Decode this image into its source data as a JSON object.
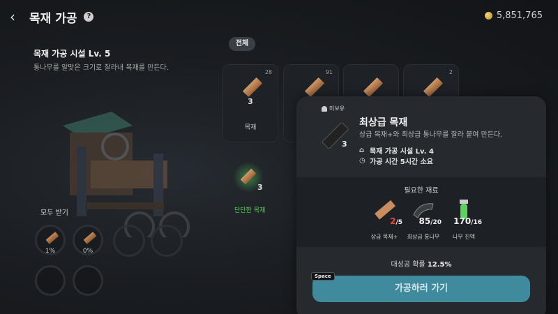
{
  "header": {
    "back_icon": "chevron-left-icon",
    "title": "목재 가공",
    "help_icon": "?",
    "coins": "5,851,765"
  },
  "facility": {
    "name": "목재 가공 시설 Lv. 5",
    "description": "통나무를 알맞은 크기로 잘라내 목재를 만든다."
  },
  "collect": {
    "label": "모두 받기",
    "slots": [
      {
        "percent": "1%"
      },
      {
        "percent": "0%"
      }
    ]
  },
  "filter": {
    "all_label": "전체"
  },
  "recipes": [
    {
      "owned": "28",
      "qty": "3",
      "name": "목재"
    },
    {
      "owned": "91",
      "qty": "",
      "name": ""
    },
    {
      "owned": "",
      "qty": "",
      "name": ""
    },
    {
      "owned": "2",
      "qty": "",
      "name": ""
    }
  ],
  "recipe_glow": {
    "qty": "3",
    "name": "단단한 목재"
  },
  "detail": {
    "unowned_label": "미보유",
    "item_qty": "3",
    "item_name": "최상급 목재",
    "item_desc": "상급 목재+와 최상급 통나무를 잘라 붙여 만든다.",
    "facility_req": "목재 가공 시설 Lv. 4",
    "time_req": "가공 시간 5시간 소요",
    "materials_title": "필요한 재료",
    "materials": [
      {
        "have": "2",
        "need": "/5",
        "label": "상급 목재+",
        "lacking": true
      },
      {
        "have": "85",
        "need": "/20",
        "label": "최상급 통나무",
        "lacking": false
      },
      {
        "have": "170",
        "need": "/16",
        "label": "나무 진액",
        "lacking": false
      }
    ],
    "success_prefix": "대성공 확률",
    "success_rate": "12.5%",
    "space_key": "Space",
    "go_button": "가공하러 가기"
  },
  "colors": {
    "accent_button": "#3f8a9c",
    "lacking_red": "#e24a3b",
    "green_glow": "#5fcf5f",
    "panel_bg": "#262a2f"
  }
}
